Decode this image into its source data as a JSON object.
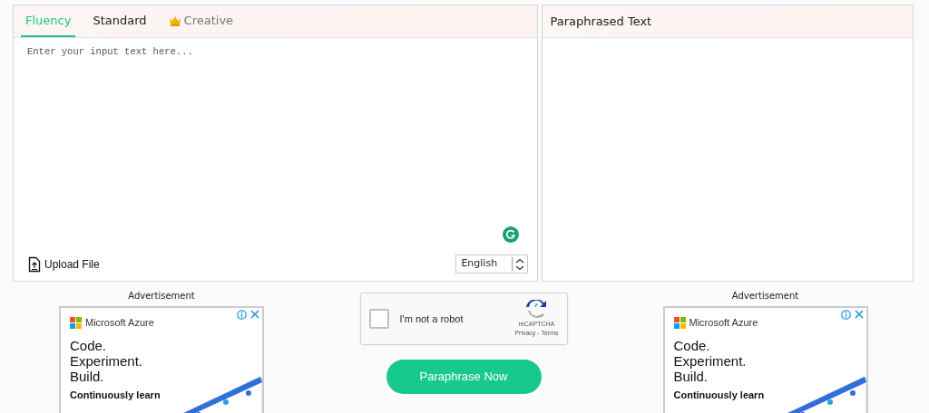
{
  "input_panel": {
    "tabs": [
      {
        "label": "Fluency",
        "selected": true,
        "premium": false
      },
      {
        "label": "Standard",
        "selected": false,
        "premium": false
      },
      {
        "label": "Creative",
        "selected": false,
        "premium": true
      }
    ],
    "placeholder": "Enter your input text here...",
    "upload_label": "Upload File",
    "language": "English"
  },
  "output_panel": {
    "title": "Paraphrased Text"
  },
  "ads": [
    {
      "label": "Advertisement",
      "brand": "Microsoft Azure",
      "headline": [
        "Code.",
        "Experiment.",
        "Build."
      ],
      "subtext": "Continuously learn"
    },
    {
      "label": "Advertisement",
      "brand": "Microsoft Azure",
      "headline": [
        "Code.",
        "Experiment.",
        "Build."
      ],
      "subtext": "Continuously learn"
    }
  ],
  "captcha": {
    "label": "I'm not a robot",
    "checked": false,
    "brand": "reCAPTCHA",
    "links": "Privacy - Terms"
  },
  "submit_button": "Paraphrase Now"
}
